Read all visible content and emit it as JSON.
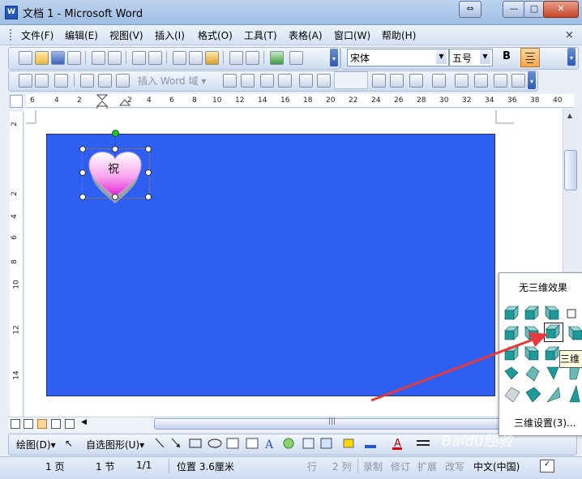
{
  "window": {
    "title": "文档 1 - Microsoft Word",
    "app_icon_letter": "W",
    "controls": {
      "restore_app": "⇔",
      "minimize": "—",
      "maximize": "□",
      "close": "✕"
    }
  },
  "menu": {
    "items": [
      "文件(F)",
      "编辑(E)",
      "视图(V)",
      "插入(I)",
      "格式(O)",
      "工具(T)",
      "表格(A)",
      "窗口(W)",
      "帮助(H)"
    ],
    "doc_close": "×"
  },
  "toolbar": {
    "font_name": "宋体",
    "font_size": "五号",
    "bold_label": "B",
    "insert_field_label": "插入 Word 域 ▾"
  },
  "ruler": {
    "h_ticks": [
      "6",
      "4",
      "2",
      "2",
      "4",
      "6",
      "8",
      "10",
      "12",
      "14",
      "16",
      "18",
      "20",
      "22",
      "24",
      "26",
      "28",
      "30",
      "32",
      "34",
      "36",
      "38",
      "40"
    ],
    "v_ticks": [
      "2",
      "2",
      "4",
      "6",
      "8",
      "10",
      "12",
      "14"
    ]
  },
  "shape": {
    "text": "祝"
  },
  "panel_3d": {
    "no_effect_label": "无三维效果",
    "tooltip": "三维",
    "settings_label": "三维设置(3)..."
  },
  "drawing_toolbar": {
    "draw_label": "绘图(D)▾",
    "autoshape_label": "自选图形(U)▾"
  },
  "status": {
    "page": "1 页",
    "section": "1 节",
    "page_of": "1/1",
    "position": "位置 3.6厘米",
    "line": "行",
    "column": "2 列",
    "rec": "录制",
    "rev": "修订",
    "ext": "扩展",
    "ovr": "改写",
    "language": "中文(中国)"
  },
  "watermark": "Baidu经验",
  "colors": {
    "canvas_fill": "#2e5ff2",
    "accent_arrow": "#e83a3a",
    "cube_face": "#1f9a9a"
  }
}
